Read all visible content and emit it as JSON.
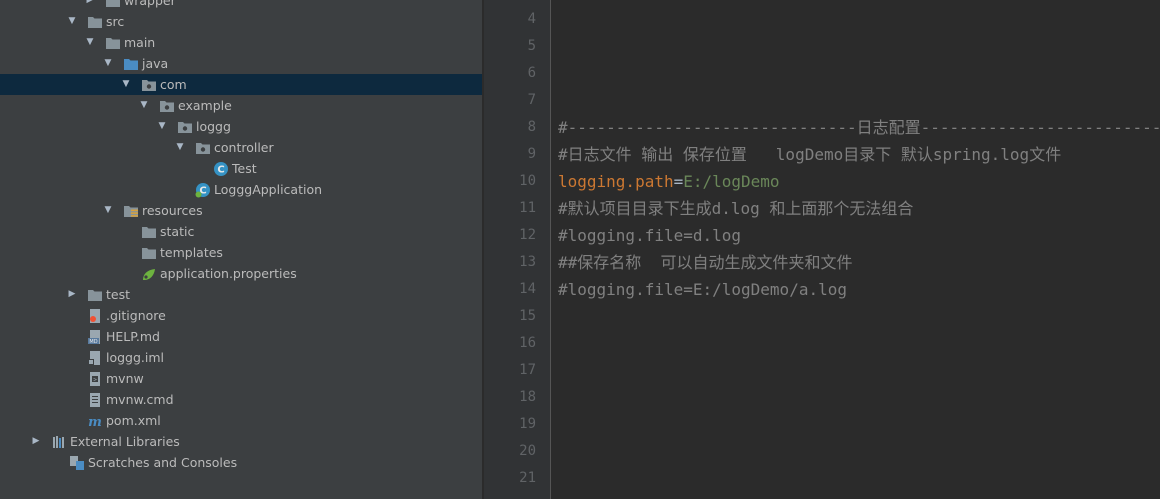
{
  "project_tree": {
    "items": [
      {
        "label": "wrapper",
        "icon": "folder-icon",
        "expanded": false,
        "selected": false
      },
      {
        "label": "src",
        "icon": "folder-icon",
        "expanded": true,
        "selected": false
      },
      {
        "label": "main",
        "icon": "folder-icon",
        "expanded": true,
        "selected": false
      },
      {
        "label": "java",
        "icon": "source-folder-icon",
        "expanded": true,
        "selected": false
      },
      {
        "label": "com",
        "icon": "package-icon",
        "expanded": true,
        "selected": true
      },
      {
        "label": "example",
        "icon": "package-icon",
        "expanded": true,
        "selected": false
      },
      {
        "label": "loggg",
        "icon": "package-icon",
        "expanded": true,
        "selected": false
      },
      {
        "label": "controller",
        "icon": "package-icon",
        "expanded": true,
        "selected": false
      },
      {
        "label": "Test",
        "icon": "java-class-icon",
        "expanded": null,
        "selected": false
      },
      {
        "label": "LogggApplication",
        "icon": "spring-boot-class-icon",
        "expanded": null,
        "selected": false
      },
      {
        "label": "resources",
        "icon": "resources-folder-icon",
        "expanded": true,
        "selected": false
      },
      {
        "label": "static",
        "icon": "folder-icon",
        "expanded": null,
        "selected": false
      },
      {
        "label": "templates",
        "icon": "folder-icon",
        "expanded": null,
        "selected": false
      },
      {
        "label": "application.properties",
        "icon": "properties-file-icon",
        "expanded": null,
        "selected": false
      },
      {
        "label": "test",
        "icon": "folder-icon",
        "expanded": false,
        "selected": false
      },
      {
        "label": ".gitignore",
        "icon": "gitignore-file-icon",
        "expanded": null,
        "selected": false
      },
      {
        "label": "HELP.md",
        "icon": "markdown-file-icon",
        "expanded": null,
        "selected": false
      },
      {
        "label": "loggg.iml",
        "icon": "iml-file-icon",
        "expanded": null,
        "selected": false
      },
      {
        "label": "mvnw",
        "icon": "script-file-icon",
        "expanded": null,
        "selected": false
      },
      {
        "label": "mvnw.cmd",
        "icon": "text-file-icon",
        "expanded": null,
        "selected": false
      },
      {
        "label": "pom.xml",
        "icon": "maven-icon",
        "expanded": null,
        "selected": false
      },
      {
        "label": "External Libraries",
        "icon": "libraries-icon",
        "expanded": false,
        "selected": false
      },
      {
        "label": "Scratches and Consoles",
        "icon": "scratches-icon",
        "expanded": null,
        "selected": false
      }
    ]
  },
  "editor": {
    "line_numbers": [
      "4",
      "5",
      "6",
      "7",
      "8",
      "9",
      "10",
      "11",
      "12",
      "13",
      "14",
      "15",
      "16",
      "17",
      "18",
      "19",
      "20",
      "21"
    ],
    "lines": [
      {
        "comment": ""
      },
      {
        "comment": ""
      },
      {
        "comment": ""
      },
      {
        "comment": ""
      },
      {
        "comment": "#------------------------------日志配置---------------------------"
      },
      {
        "comment": "#日志文件 输出 保存位置   logDemo目录下 默认spring.log文件"
      },
      {
        "key": "logging.path",
        "eq": "=",
        "value": "E:/logDemo"
      },
      {
        "comment": "#默认项目目录下生成d.log 和上面那个无法组合"
      },
      {
        "comment": "#logging.file=d.log"
      },
      {
        "comment": "##保存名称  可以自动生成文件夹和文件"
      },
      {
        "comment": "#logging.file=E:/logDemo/a.log"
      },
      {
        "comment": ""
      },
      {
        "comment": ""
      },
      {
        "comment": ""
      },
      {
        "comment": ""
      },
      {
        "comment": ""
      },
      {
        "comment": ""
      },
      {
        "comment": ""
      }
    ]
  },
  "colors": {
    "panel_bg": "#3c3f41",
    "editor_bg": "#2b2b2b",
    "gutter_bg": "#313335",
    "selection": "#0d293e",
    "comment": "#808080",
    "property_key": "#cc7832",
    "property_value": "#6a8759"
  }
}
